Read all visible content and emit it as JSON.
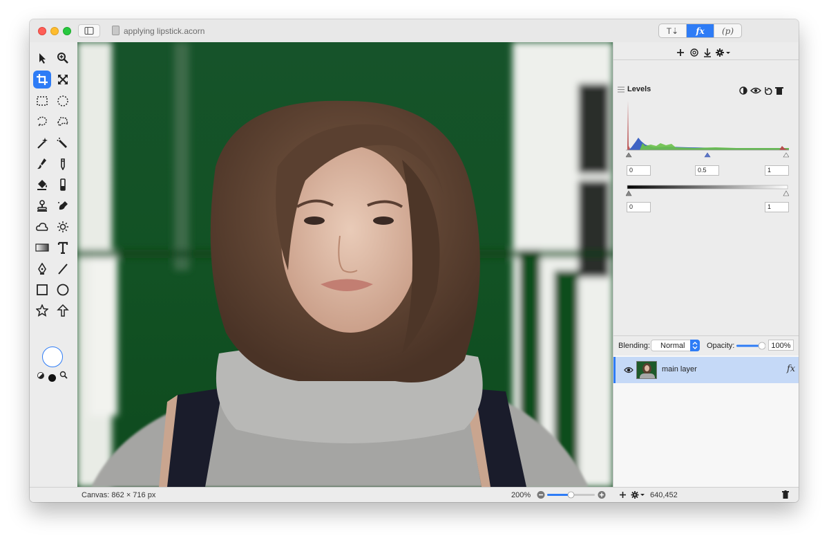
{
  "window": {
    "title": "applying lipstick.acorn"
  },
  "inspector_tabs": [
    {
      "label": "T⇣"
    },
    {
      "label": "fx"
    },
    {
      "label": "(p)"
    }
  ],
  "filters": {
    "filter_name": "Levels",
    "input_black": "0",
    "input_gamma": "0.5",
    "input_white": "1",
    "output_black": "0",
    "output_white": "1"
  },
  "layers": {
    "blending_label": "Blending:",
    "blending_mode": "Normal",
    "opacity_label": "Opacity:",
    "opacity_value": "100%",
    "opacity_fraction": 0.95,
    "items": [
      {
        "name": "main layer",
        "fx_label": "fx"
      }
    ]
  },
  "status": {
    "canvas_info": "Canvas: 862 × 716 px",
    "zoom": "200%",
    "zoom_fraction": 0.5,
    "coords": "640,452"
  },
  "colors": {
    "accent": "#2e7cf6",
    "selection": "#c5d9f7",
    "background_green": "#155a24"
  },
  "tools": [
    "pointer-icon",
    "zoom-icon",
    "crop-icon",
    "transform-icon",
    "rect-select-icon",
    "ellipse-select-icon",
    "lasso-icon",
    "polygon-lasso-icon",
    "magic-wand-icon",
    "magic-brush-icon",
    "brush-icon",
    "pencil-icon",
    "paint-bucket-icon",
    "eraser-icon",
    "clone-stamp-icon",
    "smudge-icon",
    "cloud-icon",
    "sun-icon",
    "gradient-icon",
    "text-icon",
    "pen-icon",
    "line-icon",
    "rectangle-icon",
    "oval-icon",
    "star-icon",
    "arrow-icon"
  ]
}
